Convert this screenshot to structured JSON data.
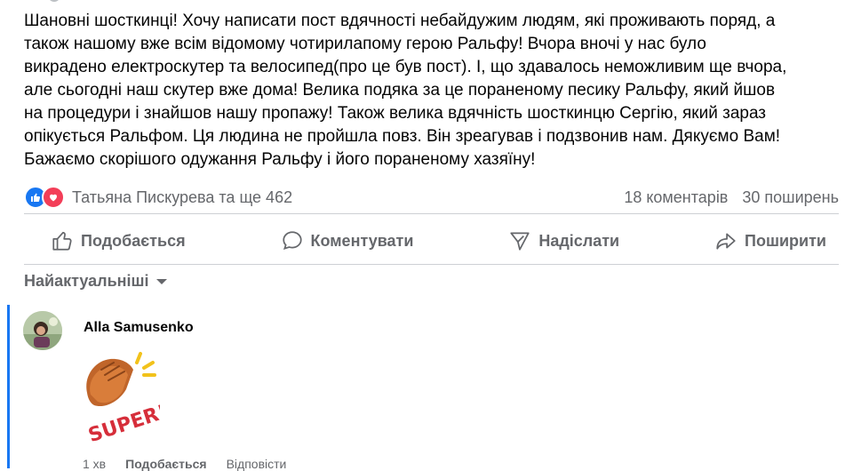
{
  "post": {
    "text": "Шановні шосткинці! Хочу написати пост вдячності небайдужим людям, які проживають поряд, а\nтакож нашому вже всім відомому чотирилапому герою Ральфу! Вчора вночі у нас було\nвикрадено електроскутер та велосипед(про це був пост). І, що здавалось неможливим ще вчора,\nале сьогодні наш скутер вже дома! Велика подяка за це пораненому песику Ральфу, який йшов\nна процедури і знайшов нашу пропажу! Також велика вдячність шосткинцю Сергію, який зараз\nопікується Ральфом. Ця людина не пройшла повз. Він зреагував і подзвонив нам. Дякуємо Вам!\nБажаємо скорішого одужання Ральфу і його пораненому хазяїну!"
  },
  "stats": {
    "reactions_text": "Татьяна Пискурева та ще 462",
    "comments": "18 коментарів",
    "shares": "30 поширень"
  },
  "actions": {
    "like": "Подобається",
    "comment": "Коментувати",
    "send": "Надіслати",
    "share": "Поширити"
  },
  "sort": {
    "label": "Найактуальніші"
  },
  "comment": {
    "author": "Alla Samusenko",
    "sticker_text": "SUPER!",
    "time": "1 хв",
    "like": "Подобається",
    "reply": "Відповісти"
  },
  "colors": {
    "accent": "#1877f2",
    "love": "#f33e58",
    "secondary_text": "#65676b"
  },
  "icons": [
    "like-reaction-icon",
    "love-reaction-icon",
    "thumbs-up-icon",
    "comment-bubble-icon",
    "send-icon",
    "share-icon",
    "caret-down-icon",
    "clapping-hands-sticker"
  ]
}
